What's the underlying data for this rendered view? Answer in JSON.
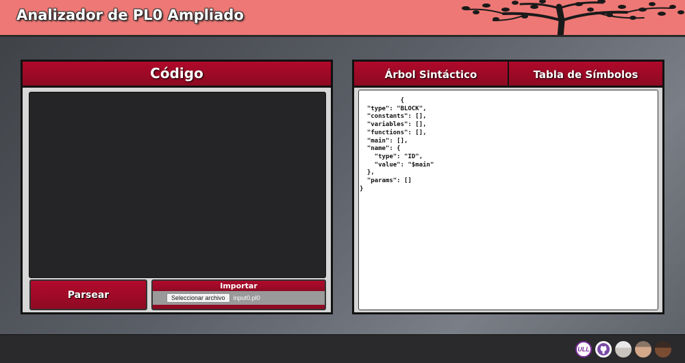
{
  "header": {
    "title": "Analizador de PL0 Ampliado",
    "accent_color": "#ee7875"
  },
  "editor": {
    "title": "Código",
    "code": "",
    "parse_button": "Parsear",
    "import": {
      "title": "Importar",
      "file_button": "Seleccionar archivo",
      "file_name": "input0.pl0"
    }
  },
  "results": {
    "tabs": [
      {
        "label": "Árbol Sintáctico"
      },
      {
        "label": "Tabla de Símbolos"
      }
    ],
    "output": "           {\n  \"type\": \"BLOCK\",\n  \"constants\": [],\n  \"variables\": [],\n  \"functions\": [],\n  \"main\": [],\n  \"name\": {\n    \"type\": \"ID\",\n    \"value\": \"$main\"\n  },\n  \"params\": []\n}"
  },
  "footer": {
    "icons": [
      "ull-logo-icon",
      "github-icon",
      "avatar-1",
      "avatar-2",
      "avatar-3"
    ]
  },
  "colors": {
    "brand_red": "#9e0a27",
    "editor_bg": "#252426"
  }
}
